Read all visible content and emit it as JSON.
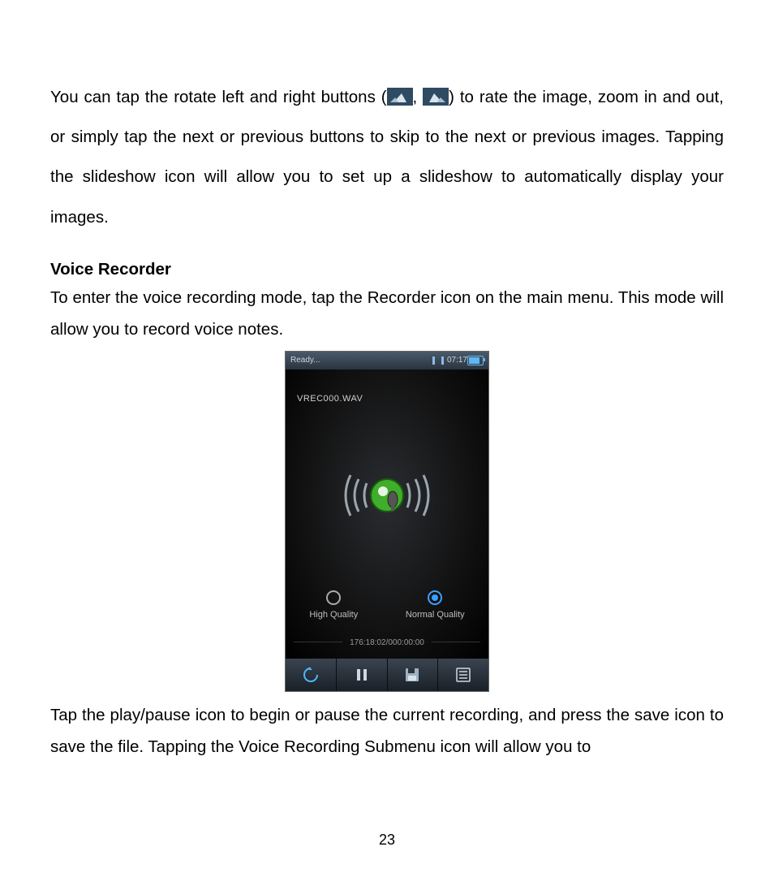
{
  "para1_a": "You can ",
  "para1_gap": "  ",
  "para1_b": "tap the rotate left and right buttons (",
  "para1_c": ", ",
  "para1_d": ") to rate the image, zoom in and out, or simply tap the next or previous buttons to skip to the next or previous images. Tapping the slideshow icon will allow you to set up a slideshow to automatically display your images.",
  "heading": "Voice Recorder",
  "para2": "To enter the voice recording mode, tap the Recorder icon on the main menu. This mode will allow you to record voice notes.",
  "phone": {
    "status_left": "Ready...",
    "status_time": "07:17",
    "filename": "VREC000.WAV",
    "quality_high": "High Quality",
    "quality_normal": "Normal Quality",
    "time": "176:18:02/000:00:00"
  },
  "para3": "Tap the play/pause icon to begin or pause the current recording, and press the save icon to save the file. Tapping the Voice Recording Submenu icon will allow you to",
  "page_number": "23"
}
